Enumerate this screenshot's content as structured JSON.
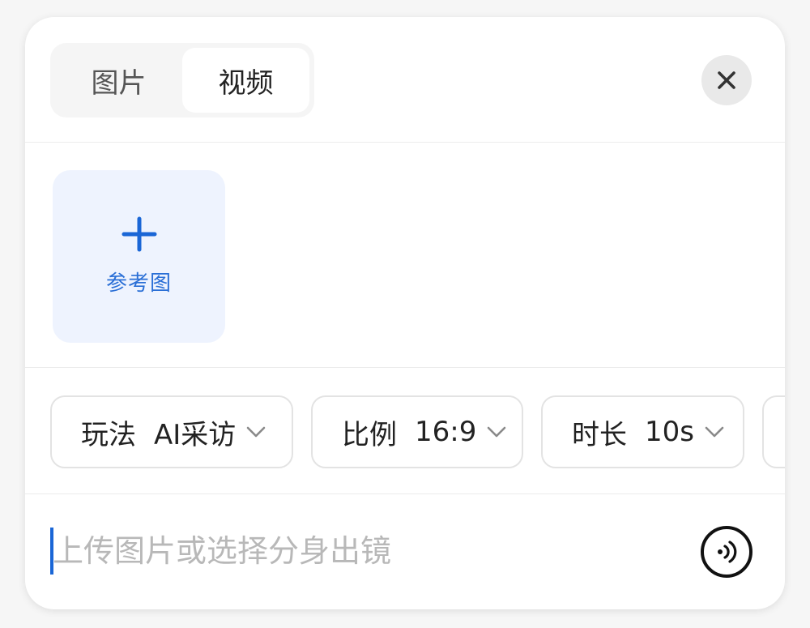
{
  "tabs": [
    {
      "label": "图片",
      "active": false
    },
    {
      "label": "视频",
      "active": true
    }
  ],
  "close": {
    "icon": "close-icon"
  },
  "reference": {
    "label": "参考图",
    "icon": "plus-icon",
    "accent": "#1a66d6"
  },
  "options": [
    {
      "key": "玩法",
      "value": "AI采访"
    },
    {
      "key": "比例",
      "value": "16:9"
    },
    {
      "key": "时长",
      "value": "10s"
    }
  ],
  "prompt": {
    "placeholder": "上传图片或选择分身出镜",
    "value": ""
  },
  "voice": {
    "icon": "voice-icon"
  }
}
